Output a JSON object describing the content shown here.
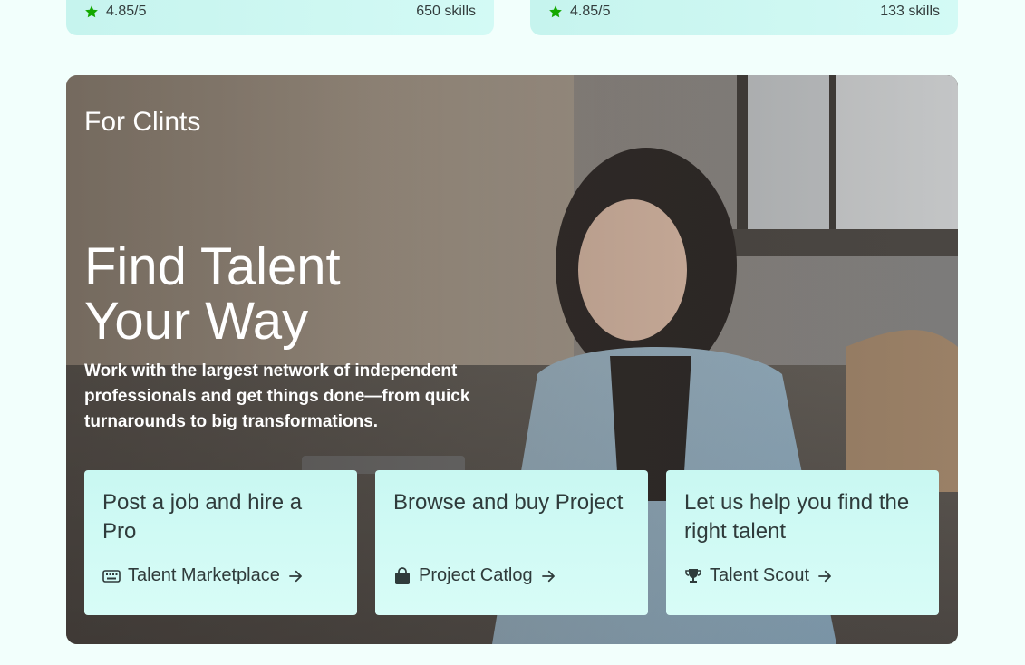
{
  "top_cards": [
    {
      "rating": "4.85/5",
      "skills": "650 skills",
      "icon": "star-icon"
    },
    {
      "rating": "4.85/5",
      "skills": "133 skills",
      "icon": "star-icon"
    }
  ],
  "hero": {
    "eyebrow": "For Clints",
    "headline_line1": "Find Talent",
    "headline_line2": "Your Way",
    "subtext": "Work with the largest network of independent professionals and get things done—from quick turnarounds to big transformations."
  },
  "cards": [
    {
      "title": "Post a job and hire a Pro",
      "link_label": "Talent Marketplace",
      "icon": "keyboard-icon"
    },
    {
      "title": "Browse and buy Project",
      "link_label": "Project Catlog",
      "icon": "shopping-bag-icon"
    },
    {
      "title": "Let us help you find the right talent",
      "link_label": "Talent Scout",
      "icon": "trophy-icon"
    }
  ],
  "colors": {
    "accent_green": "#14a800",
    "card_bg": "#c9f8f2",
    "page_bg": "#f2fffc"
  }
}
